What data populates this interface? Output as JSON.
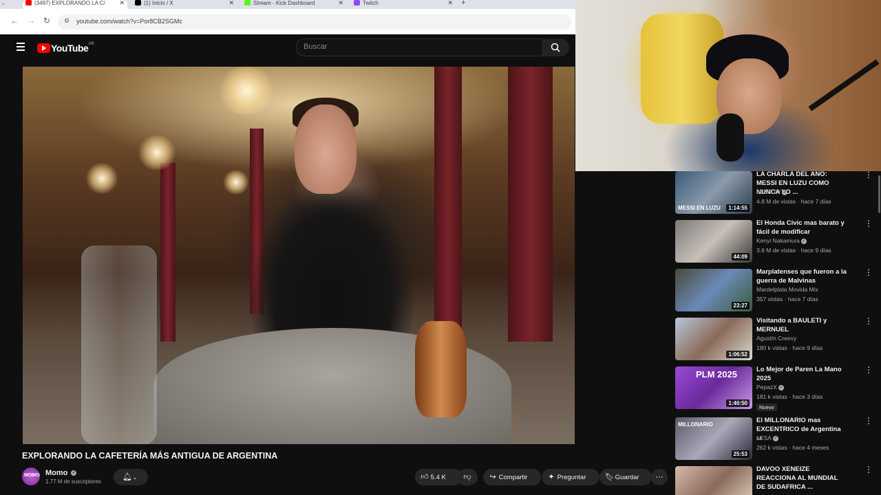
{
  "browser": {
    "tabs": [
      {
        "title": "(3497) EXPLORANDO LA C/",
        "icon_color": "#ff0000",
        "active": true
      },
      {
        "title": "(1) Inicio / X",
        "icon_color": "#000000",
        "active": false
      },
      {
        "title": "Stream - Kick Dashboard",
        "icon_color": "#53fc18",
        "active": false
      },
      {
        "title": "Twitch",
        "icon_color": "#9146ff",
        "active": false
      }
    ],
    "new_tab": "+",
    "url": "youtube.com/watch?v=Por8CB2SGMc"
  },
  "youtube": {
    "logo_text": "YouTube",
    "region": "AR",
    "search_placeholder": "Buscar"
  },
  "video": {
    "title": "EXPLORANDO LA CAFETERÍA MÁS ANTIGUA DE ARGENTINA",
    "channel": "Momo",
    "channel_avatar_text": "MOMO",
    "subscribers": "1.77 M de suscriptores",
    "likes": "5.4 K",
    "share_label": "Compartir",
    "ask_label": "Preguntar",
    "save_label": "Guardar"
  },
  "recommendations": [
    {
      "title": "LA CHARLA DEL AÑO: MESSI EN LUZU COMO NUNCA LO ...",
      "channel": "LUZU TV",
      "verified": true,
      "meta": "4.8 M de vistas · hace 7 días",
      "duration": "1:14:55",
      "thumb_text": "MESSI EN LUZU",
      "thumb_color": "#3a5a7a"
    },
    {
      "title": "El Honda Civic mas barato y fácil de modificar",
      "channel": "Kenyi Nakamura",
      "verified": true,
      "meta": "3.6 M de vistas · hace 9 días",
      "duration": "44:09",
      "thumb_text": "",
      "thumb_color": "#6a6a6a"
    },
    {
      "title": "Marplatenses que fueron a la guerra de Malvinas",
      "channel": "Mardelplata Movida Mix",
      "verified": false,
      "meta": "357 vistas · hace 7 días",
      "duration": "23:27",
      "thumb_text": "",
      "thumb_color": "#5a6a5a"
    },
    {
      "title": "Visitando a BAULETI y MERNUEL",
      "channel": "Agustín Creevy",
      "verified": false,
      "meta": "180 k vistas · hace 9 días",
      "duration": "1:06:52",
      "thumb_text": "",
      "thumb_color": "#7a8a9a"
    },
    {
      "title": "Lo Mejor de Paren La Mano 2025",
      "channel": "PepazX",
      "verified": true,
      "meta": "181 k vistas · hace 3 días",
      "duration": "1:40:50",
      "thumb_text": "PLM 2025",
      "thumb_color": "#7a3ab8",
      "badge": "Nuevo"
    },
    {
      "title": "El MILLONARIO mas EXCENTRICO de Argentina",
      "channel": "LESA",
      "verified": true,
      "meta": "262 k vistas · hace 4 meses",
      "duration": "25:53",
      "thumb_text": "MILLONARIO",
      "thumb_color": "#4a4a5a",
      "title_suffix": "AR"
    },
    {
      "title": "DAVOO XENEIZE REACCIONA AL MUNDIAL DE SUDAFRICA ...",
      "channel": "",
      "verified": false,
      "meta": "",
      "duration": "",
      "thumb_text": "",
      "thumb_color": "#8a6a5a"
    }
  ]
}
